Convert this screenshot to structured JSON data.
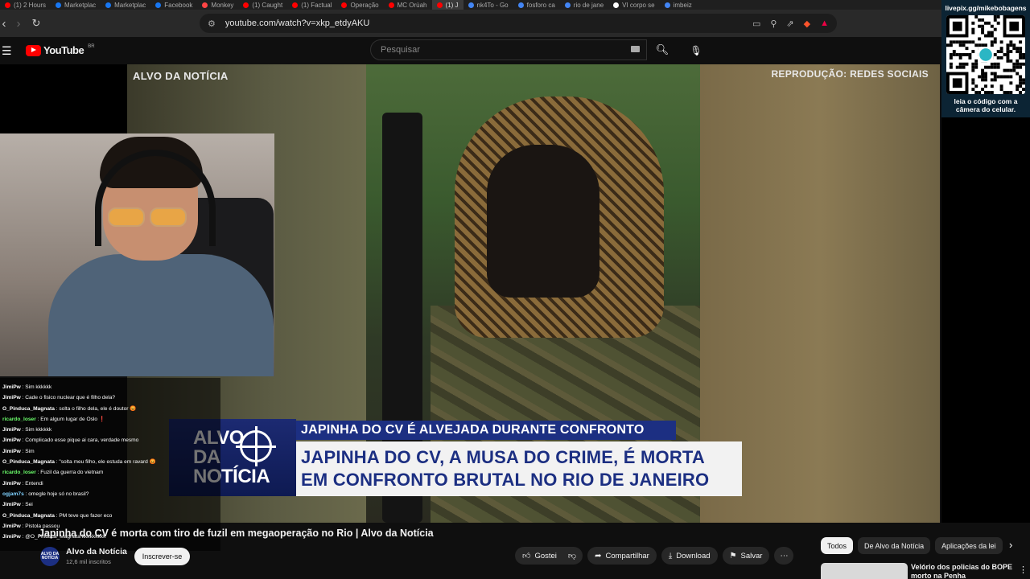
{
  "browser": {
    "tabs": [
      {
        "label": "(1) 2 Hours",
        "color": "#ff0000"
      },
      {
        "label": "Marketplac",
        "color": "#1877f2"
      },
      {
        "label": "Marketplac",
        "color": "#1877f2"
      },
      {
        "label": "Facebook",
        "color": "#1877f2"
      },
      {
        "label": "Monkey",
        "color": "#ff4444"
      },
      {
        "label": "(1) Caught",
        "color": "#ff0000"
      },
      {
        "label": "(1) Factual",
        "color": "#ff0000"
      },
      {
        "label": "Operação",
        "color": "#ff0000"
      },
      {
        "label": "MC Orùah",
        "color": "#ff0000"
      },
      {
        "label": "(1) J",
        "color": "#ff0000",
        "active": true
      },
      {
        "label": "nk4To - Go",
        "color": "#4285f4"
      },
      {
        "label": "fosforo ca",
        "color": "#4285f4"
      },
      {
        "label": "rio de jane",
        "color": "#4285f4"
      },
      {
        "label": "VI corpo se",
        "color": "#ffffff"
      },
      {
        "label": "imbeiz",
        "color": "#4285f4"
      }
    ],
    "url": "youtube.com/watch?v=xkp_etdyAKU"
  },
  "youtube": {
    "logo_text": "YouTube",
    "region": "BR",
    "search_placeholder": "Pesquisar"
  },
  "video": {
    "watermark_left": "ALVO DA NOTÍCIA",
    "watermark_right": "REPRODUÇÃO: REDES SOCIAIS",
    "banner": {
      "logo_line1": "ALVO",
      "logo_line2": "DA",
      "logo_line3": "NOTÍCIA",
      "top_strip": "JAPINHA DO CV É ALVEJADA DURANTE CONFRONTO",
      "headline_line1": "JAPINHA DO CV, A MUSA DO CRIME, É MORTA",
      "headline_line2": "EM CONFRONTO BRUTAL NO RIO DE JANEIRO"
    }
  },
  "chat": [
    {
      "user": "JimiPw",
      "color": "#ffffff",
      "msg": "Sim kkkkkk"
    },
    {
      "user": "JimiPw",
      "color": "#ffffff",
      "msg": "Cade o fisico nuclear que é filho dela?"
    },
    {
      "user": "O_Pinduca_Magnata",
      "color": "#ffffff",
      "msg": "solta o filho dela, ele é doutor 😡"
    },
    {
      "user": "ricardo_loser",
      "color": "#6cff6c",
      "msg": "Em algum lugar de Oslo ❗"
    },
    {
      "user": "JimiPw",
      "color": "#ffffff",
      "msg": "Sim kkkkkk"
    },
    {
      "user": "JimiPw",
      "color": "#ffffff",
      "msg": "Complicado esse pique ai cara, verdade mesmo"
    },
    {
      "user": "JimiPw",
      "color": "#ffffff",
      "msg": "Sim"
    },
    {
      "user": "O_Pinduca_Magnata",
      "color": "#ffffff",
      "msg": "\"solta meu filho, ele estuda em ravard 😡"
    },
    {
      "user": "ricardo_loser",
      "color": "#6cff6c",
      "msg": "Fuzil da guerra do vietnam"
    },
    {
      "user": "JimiPw",
      "color": "#ffffff",
      "msg": "Entendi"
    },
    {
      "user": "ogjam7s",
      "color": "#7fd1ff",
      "msg": "omegle hoje só no brasil?"
    },
    {
      "user": "JimiPw",
      "color": "#ffffff",
      "msg": "Sei"
    },
    {
      "user": "O_Pinduca_Magnata",
      "color": "#ffffff",
      "msg": "PM teve que fazer eco"
    },
    {
      "user": "JimiPw",
      "color": "#ffffff",
      "msg": "Pistola passou"
    },
    {
      "user": "JimiPw",
      "color": "#ffffff",
      "msg": "@O_Pinduca_Magnata kkkkkkkkk"
    }
  ],
  "qr": {
    "url": "livepix.gg/mikebobagens",
    "caption_line1": "leia o código com a",
    "caption_line2": "câmera do celular."
  },
  "below": {
    "title": "Japinha do CV é morta com tiro de fuzil em megaoperação no Rio | Alvo da Notícia",
    "channel_avatar": "ALVO DA NOTÍCIA",
    "channel": "Alvo da Notícia",
    "subs": "12,6 mil inscritos",
    "subscribe": "Inscrever-se",
    "actions": {
      "like": "Gostei",
      "share": "Compartilhar",
      "download": "Download",
      "save": "Salvar"
    },
    "chips": [
      "Todos",
      "De Alvo da Notícia",
      "Aplicações da lei"
    ],
    "related_title": "Velório dos  policias do BOPE morto na Penha"
  }
}
